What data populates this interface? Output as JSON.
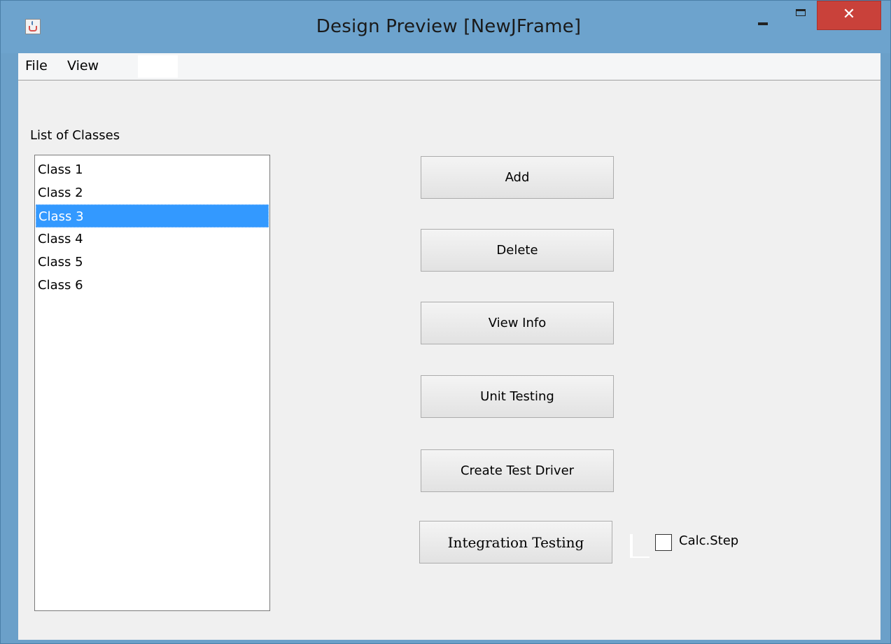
{
  "window": {
    "title": "Design Preview [NewJFrame]",
    "close_glyph": "✕",
    "controls": [
      "minimize-icon",
      "maximize-icon",
      "close-icon"
    ]
  },
  "menubar": {
    "items": [
      {
        "label": "File"
      },
      {
        "label": "View"
      }
    ]
  },
  "classes_panel": {
    "label": "List of Classes",
    "items": [
      "Class 1",
      "Class 2",
      "Class 3",
      "Class 4",
      "Class 5",
      "Class 6"
    ],
    "selected": "Class 3"
  },
  "buttons": {
    "add": "Add",
    "delete": "Delete",
    "view_info": "View Info",
    "unit_testing": "Unit Testing",
    "create_test_driver": "Create Test Driver",
    "integration_testing": "Integration Testing"
  },
  "options": {
    "calc_step_label": "Calc.Step",
    "calc_step_checked": false
  },
  "colors": {
    "titlebar": "#6da3cd",
    "close_button": "#c9413a",
    "selection": "#3399ff",
    "panel": "#f0f0f0"
  }
}
